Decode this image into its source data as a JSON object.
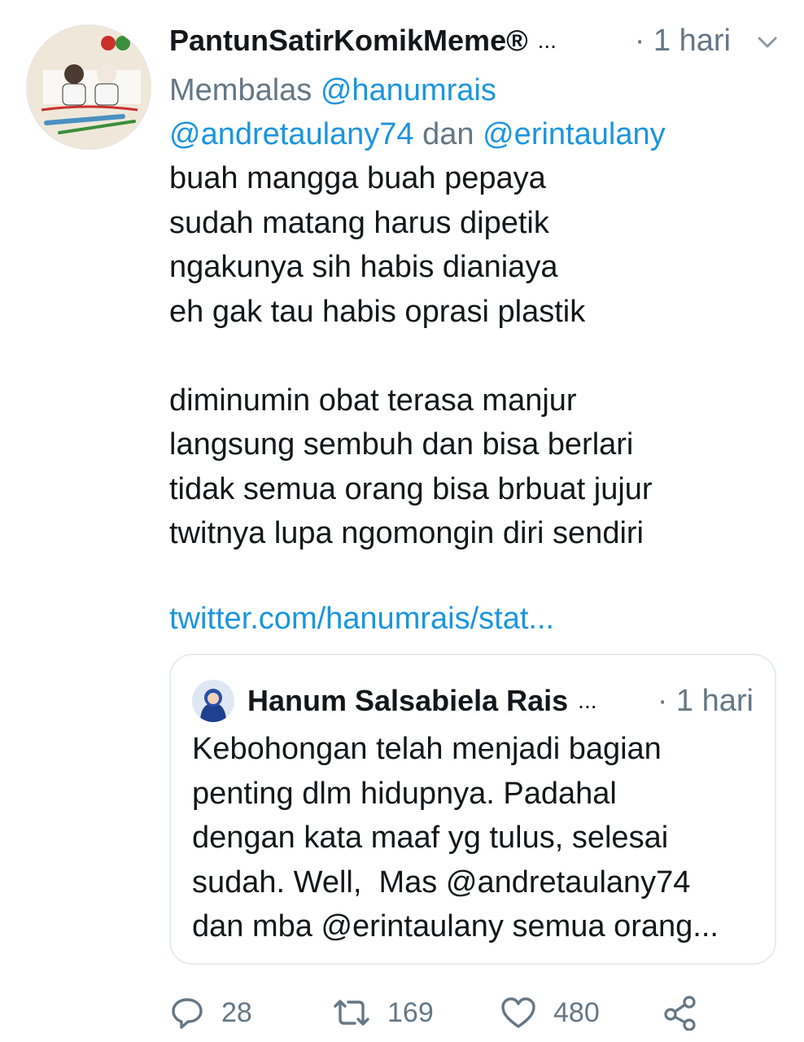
{
  "tweet": {
    "author_name": "PantunSatirKomikMeme®",
    "name_overflow": "...",
    "time": "· 1 hari",
    "reply_prefix": "Membalas ",
    "reply_to_1": "@hanumrais",
    "reply_to_2": "@andretaulany74",
    "reply_join": " dan ",
    "reply_to_3": "@erintaulany",
    "lines": [
      "buah mangga buah pepaya",
      "sudah matang harus dipetik",
      "ngakunya sih habis dianiaya",
      "eh gak tau habis oprasi plastik",
      "diminumin obat terasa manjur",
      "langsung sembuh dan bisa berlari",
      "tidak semua orang bisa brbuat jujur",
      "twitnya lupa ngomongin diri sendiri"
    ],
    "link": "twitter.com/hanumrais/stat..."
  },
  "quote": {
    "author_name": "Hanum Salsabiela Rais",
    "name_overflow": "...",
    "time": "· 1 hari",
    "line_1": "Kebohongan telah menjadi bagian",
    "line_2": "penting dlm hidupnya. Padahal",
    "line_3": "dengan kata maaf yg tulus, selesai",
    "line_4_prefix": "sudah. Well,  Mas ",
    "line_4_mention": "@andretaulany74",
    "line_5_prefix": "dan mba ",
    "line_5_mention": "@erintaulany",
    "line_5_suffix": " semua orang..."
  },
  "actions": {
    "reply_count": "28",
    "retweet_count": "169",
    "like_count": "480"
  },
  "colors": {
    "link": "#1b95e0",
    "secondary": "#657786",
    "text": "#14171a",
    "border": "#e6ecf0"
  },
  "icons": [
    "avatar",
    "chevron-down-icon",
    "reply-icon",
    "retweet-icon",
    "like-icon",
    "share-icon"
  ]
}
